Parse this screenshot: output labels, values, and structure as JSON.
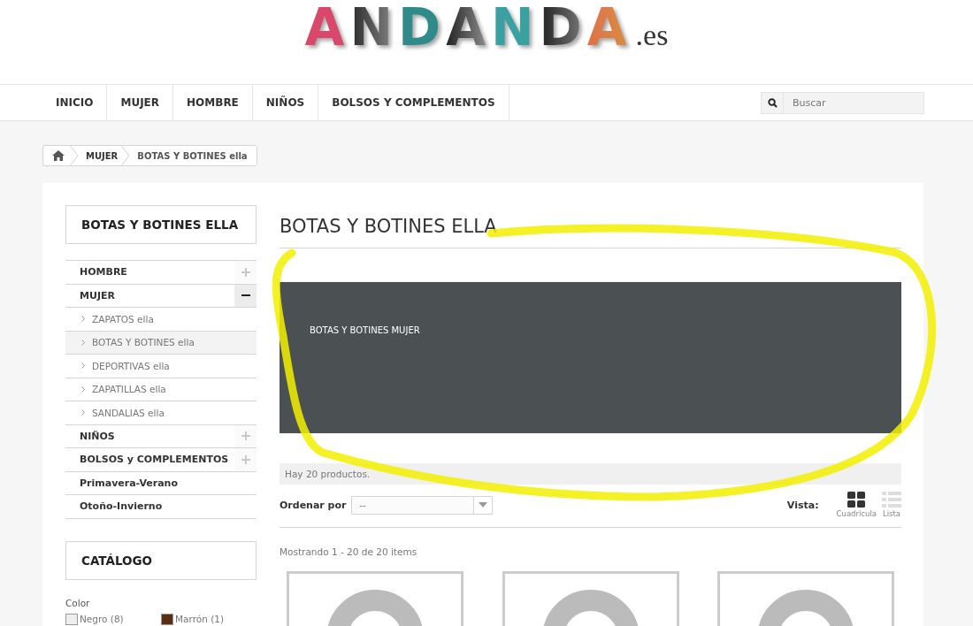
{
  "logo": {
    "name": "ANDANDA",
    "suffix": ".es"
  },
  "nav": {
    "items": [
      {
        "label": "INICIO",
        "selected": false
      },
      {
        "label": "MUJER",
        "selected": false
      },
      {
        "label": "HOMBRE",
        "selected": false
      },
      {
        "label": "NIÑOS",
        "selected": false
      },
      {
        "label": "BOLSOS Y COMPLEMENTOS",
        "selected": false
      }
    ],
    "search": {
      "placeholder": "Buscar"
    }
  },
  "breadcrumb": [
    "MUJER",
    "BOTAS Y BOTINES ella"
  ],
  "sidebar": {
    "title": "BOTAS Y BOTINES ELLA",
    "items": [
      {
        "label": "HOMBRE",
        "expanded": false,
        "selected": false
      },
      {
        "label": "MUJER",
        "expanded": true,
        "selected": false,
        "children": [
          {
            "label": "ZAPATOS ella",
            "selected": false
          },
          {
            "label": "BOTAS Y BOTINES ella",
            "selected": true
          },
          {
            "label": "DEPORTIVAS ella",
            "selected": false
          },
          {
            "label": "ZAPATILLAS ella",
            "selected": false
          },
          {
            "label": "SANDALIAS ella",
            "selected": false
          }
        ]
      },
      {
        "label": "NIÑOS",
        "expanded": false,
        "selected": false
      },
      {
        "label": "BOLSOS y COMPLEMENTOS",
        "expanded": false,
        "selected": false
      },
      {
        "label": "Primavera-Verano",
        "selected": false
      },
      {
        "label": "Otoño-Invierno",
        "selected": false
      }
    ],
    "catalog_title": "CATÁLOGO",
    "filter": {
      "label": "Color",
      "options": [
        {
          "label": "Negro (8)",
          "color": "#eeeeee"
        },
        {
          "label": "Marrón (1)",
          "color": "#5a2e12"
        }
      ]
    }
  },
  "content": {
    "title": "BOTAS Y BOTINES ELLA",
    "banner_text": "BOTAS Y BOTINES MUJER",
    "count": "Hay 20 productos.",
    "sort": {
      "label": "Ordenar por",
      "value": "--"
    },
    "view": {
      "label": "Vista:",
      "options": [
        {
          "label": "Cuadrícula",
          "kind": "grid",
          "selected": true
        },
        {
          "label": "Lista",
          "kind": "list",
          "selected": false
        }
      ]
    },
    "showing": "Mostrando 1 - 20 de 20 items",
    "products": [
      {
        "kind": "placeholder"
      },
      {
        "kind": "placeholder"
      },
      {
        "kind": "placeholder"
      }
    ]
  }
}
